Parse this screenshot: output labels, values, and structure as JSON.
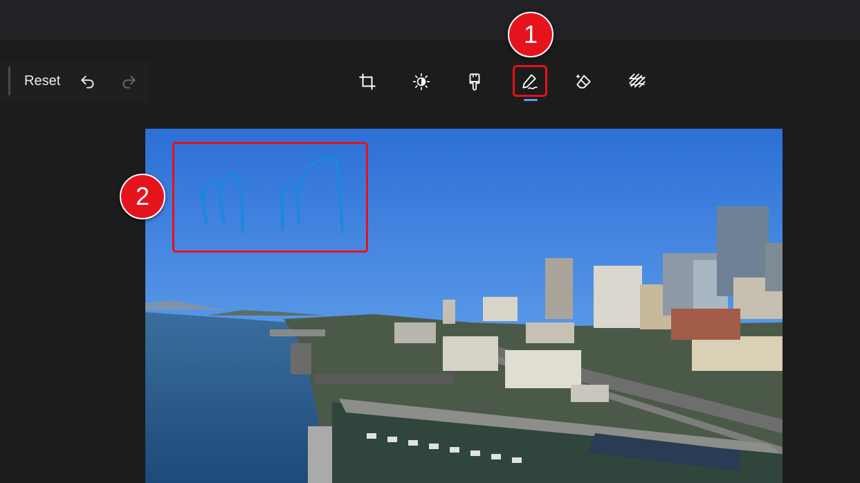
{
  "toolbar": {
    "reset_label": "Reset",
    "undo_icon": "undo-icon",
    "redo_icon": "redo-icon"
  },
  "tools": [
    {
      "name": "crop-icon"
    },
    {
      "name": "adjustment-icon"
    },
    {
      "name": "filter-brush-icon"
    },
    {
      "name": "markup-pen-icon",
      "selected": true
    },
    {
      "name": "erase-icon"
    },
    {
      "name": "background-icon"
    }
  ],
  "annotations": {
    "badge_1": "1",
    "badge_2": "2"
  },
  "colors": {
    "accent": "#4ea6e8",
    "highlight": "#e8101c",
    "badge": "#e5141c",
    "ink": "#1f86e0"
  }
}
